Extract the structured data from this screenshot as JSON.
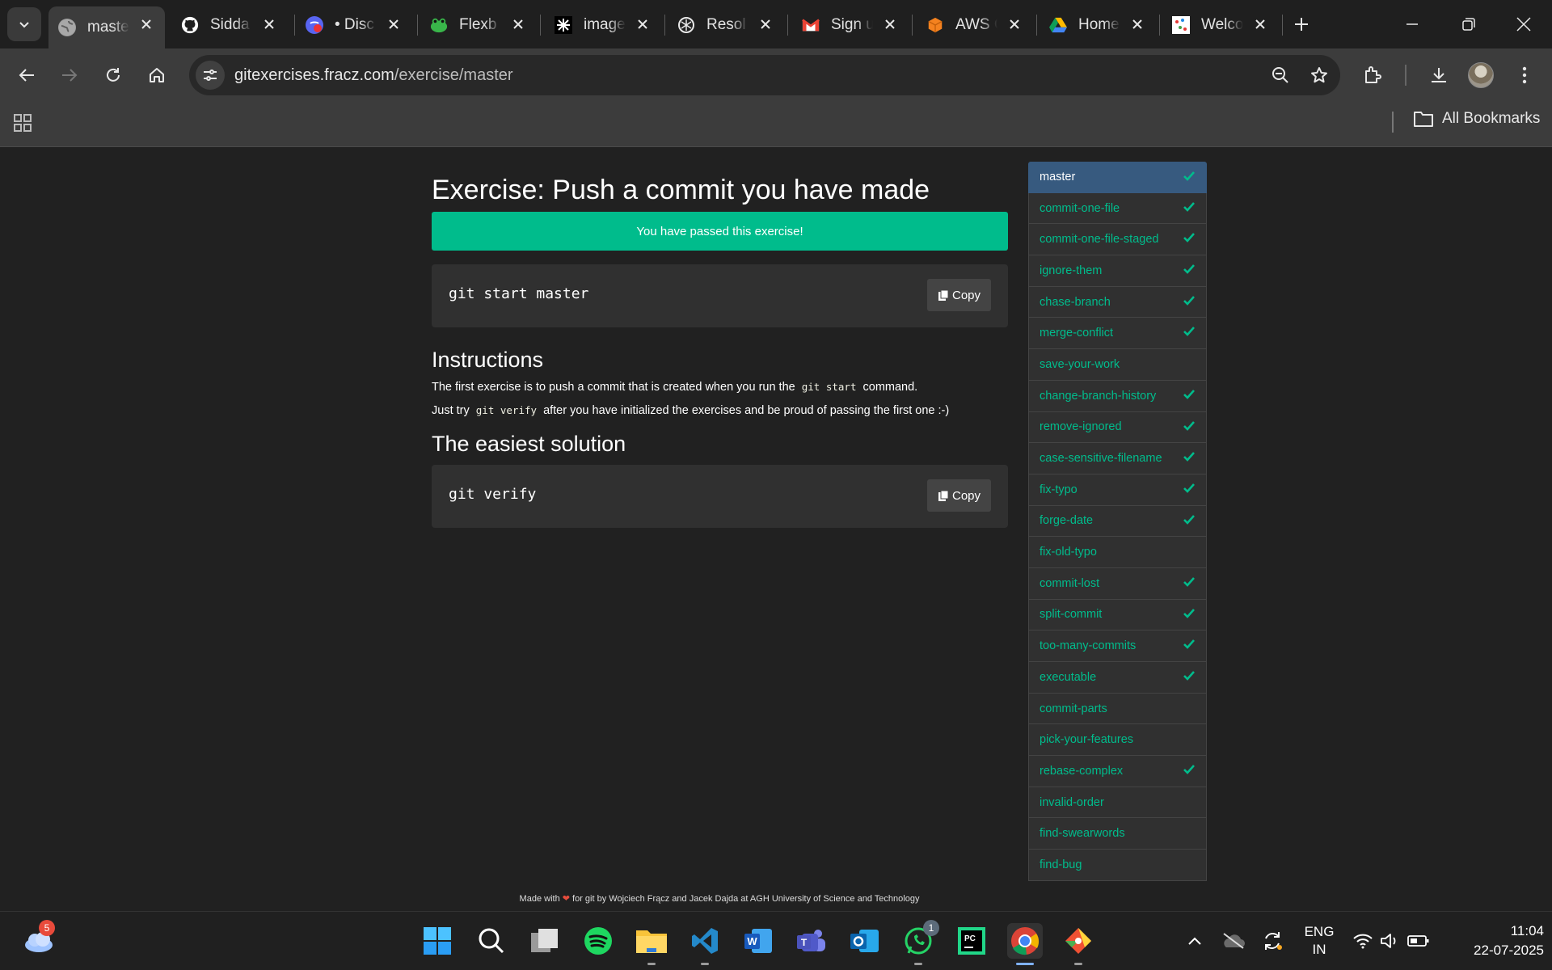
{
  "browser": {
    "tabs": [
      {
        "title": "maste",
        "active": true,
        "favicon": "globe-icon"
      },
      {
        "title": "Sidda",
        "favicon": "github-icon"
      },
      {
        "title": "• Disc",
        "favicon": "discord-icon"
      },
      {
        "title": "Flexb",
        "favicon": "frog-icon"
      },
      {
        "title": "image",
        "favicon": "sparkle-icon"
      },
      {
        "title": "Resol",
        "favicon": "openai-icon"
      },
      {
        "title": "Sign u",
        "favicon": "gmail-icon"
      },
      {
        "title": "AWS C",
        "favicon": "aws-icon"
      },
      {
        "title": "Home",
        "favicon": "drive-icon"
      },
      {
        "title": "Welco",
        "favicon": "dots-icon"
      }
    ],
    "url_domain": "gitexercises.fracz.com",
    "url_path": "/exercise/master",
    "all_bookmarks_label": "All Bookmarks"
  },
  "exercise": {
    "title": "Exercise: Push a commit you have made",
    "passed_message": "You have passed this exercise!",
    "start_command": "git start master",
    "copy_label": "Copy",
    "instructions_heading": "Instructions",
    "instructions_line1_before": "The first exercise is to push a commit that is created when you run the",
    "instructions_line1_code": "git start",
    "instructions_line1_after": "command.",
    "instructions_line2_before": "Just try",
    "instructions_line2_code": "git verify",
    "instructions_line2_after": "after you have initialized the exercises and be proud of passing the first one :-)",
    "solution_heading": "The easiest solution",
    "solution_command": "git verify"
  },
  "sidebar": {
    "items": [
      {
        "label": "master",
        "done": true,
        "active": true
      },
      {
        "label": "commit-one-file",
        "done": true
      },
      {
        "label": "commit-one-file-staged",
        "done": true
      },
      {
        "label": "ignore-them",
        "done": true
      },
      {
        "label": "chase-branch",
        "done": true
      },
      {
        "label": "merge-conflict",
        "done": true
      },
      {
        "label": "save-your-work",
        "done": false
      },
      {
        "label": "change-branch-history",
        "done": true
      },
      {
        "label": "remove-ignored",
        "done": true
      },
      {
        "label": "case-sensitive-filename",
        "done": true
      },
      {
        "label": "fix-typo",
        "done": true
      },
      {
        "label": "forge-date",
        "done": true
      },
      {
        "label": "fix-old-typo",
        "done": false
      },
      {
        "label": "commit-lost",
        "done": true
      },
      {
        "label": "split-commit",
        "done": true
      },
      {
        "label": "too-many-commits",
        "done": true
      },
      {
        "label": "executable",
        "done": true
      },
      {
        "label": "commit-parts",
        "done": false
      },
      {
        "label": "pick-your-features",
        "done": false
      },
      {
        "label": "rebase-complex",
        "done": true
      },
      {
        "label": "invalid-order",
        "done": false
      },
      {
        "label": "find-swearwords",
        "done": false
      },
      {
        "label": "find-bug",
        "done": false
      }
    ]
  },
  "footer": {
    "before": "Made with",
    "after": "for git by Wojciech Frącz and Jacek Dajda at AGH University of Science and Technology"
  },
  "taskbar": {
    "weather_badge": "5",
    "whatsapp_badge": "1",
    "language_line1": "ENG",
    "language_line2": "IN",
    "time": "11:04",
    "date": "22-07-2025"
  },
  "colors": {
    "accent": "#00bc8c",
    "active_item": "#375a7f",
    "page_bg": "#212121",
    "panel_bg": "#303030"
  }
}
